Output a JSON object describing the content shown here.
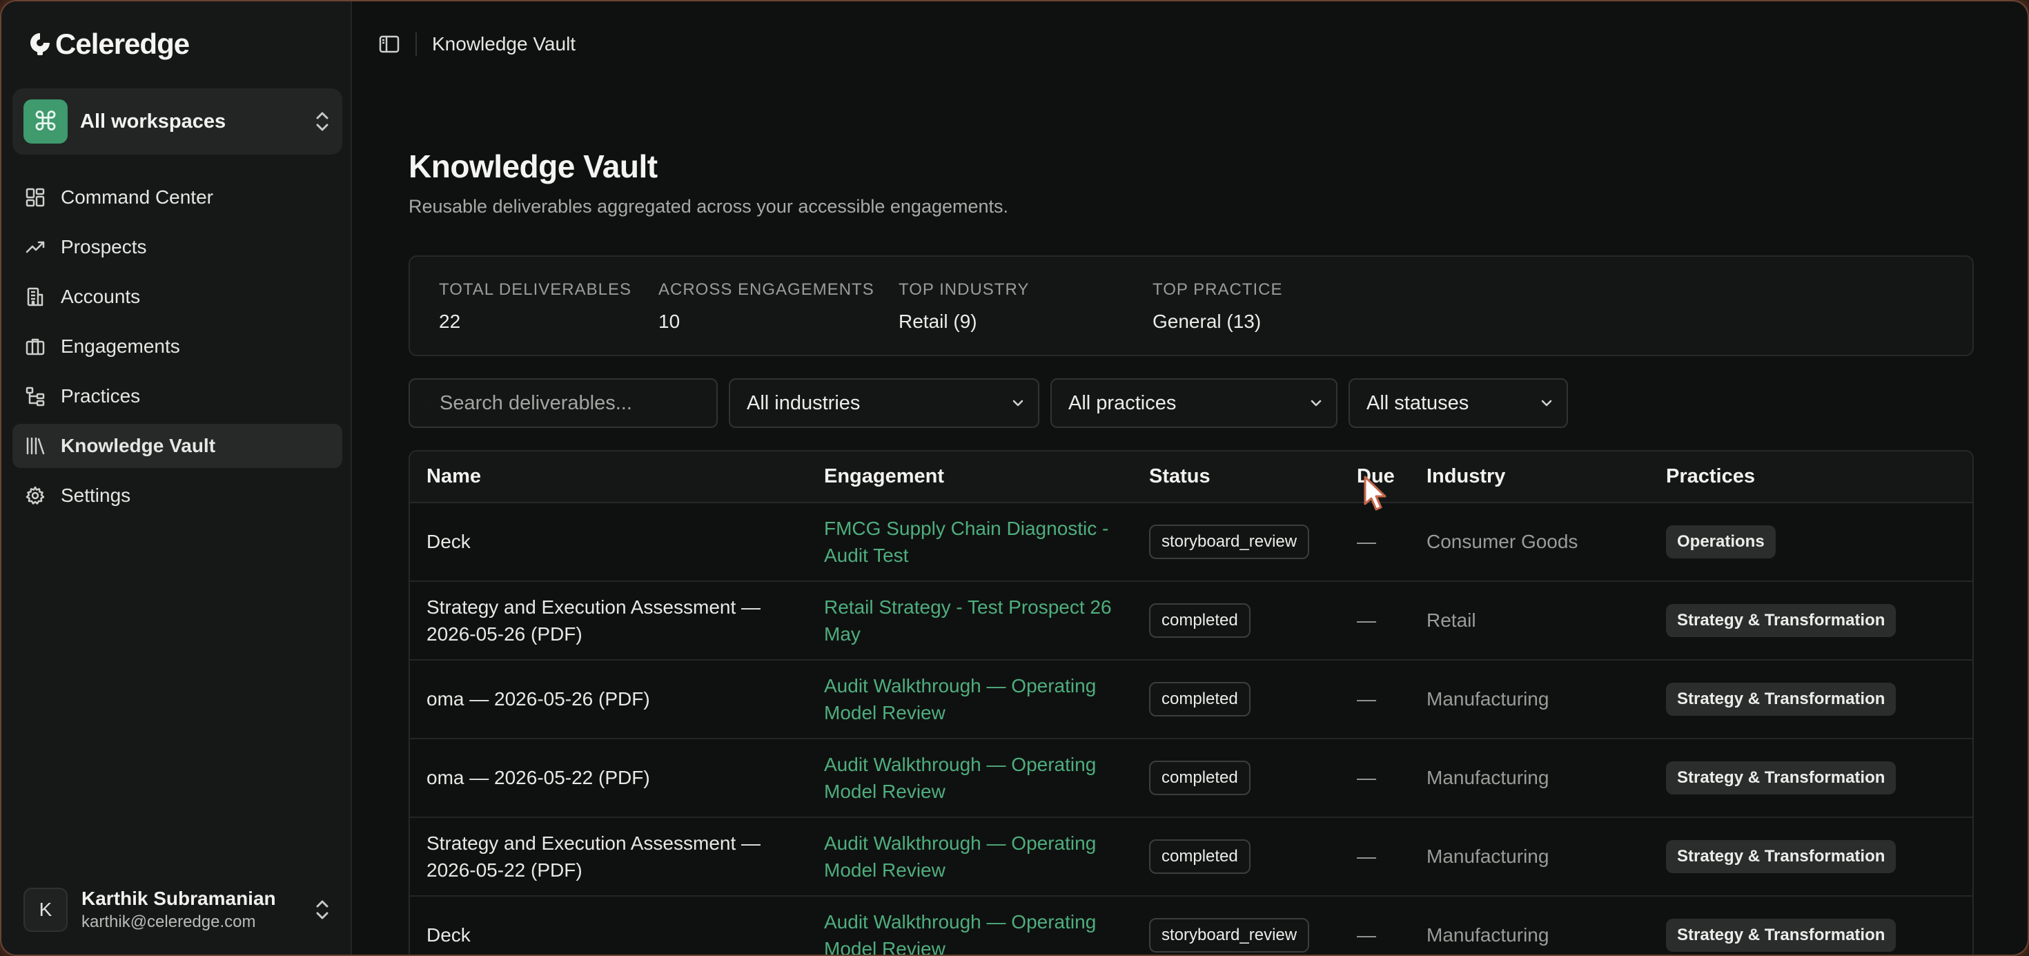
{
  "brand": {
    "name": "Celeredge",
    "icon": "celeredge-logo"
  },
  "workspace": {
    "label": "All workspaces",
    "icon": "command-icon",
    "glyph": "⌘"
  },
  "nav": [
    {
      "label": "Command Center",
      "icon": "dashboard-icon",
      "active": false
    },
    {
      "label": "Prospects",
      "icon": "trending-up-icon",
      "active": false
    },
    {
      "label": "Accounts",
      "icon": "building-icon",
      "active": false
    },
    {
      "label": "Engagements",
      "icon": "briefcase-icon",
      "active": false
    },
    {
      "label": "Practices",
      "icon": "tree-icon",
      "active": false
    },
    {
      "label": "Knowledge Vault",
      "icon": "library-icon",
      "active": true
    },
    {
      "label": "Settings",
      "icon": "gear-icon",
      "active": false
    }
  ],
  "user": {
    "initial": "K",
    "name": "Karthik Subramanian",
    "email": "karthik@celeredge.com"
  },
  "topbar": {
    "breadcrumb": "Knowledge Vault"
  },
  "page": {
    "title": "Knowledge Vault",
    "subtitle": "Reusable deliverables aggregated across your accessible engagements."
  },
  "stats": [
    {
      "label": "Total deliverables",
      "value": "22"
    },
    {
      "label": "Across engagements",
      "value": "10"
    },
    {
      "label": "Top industry",
      "value": "Retail (9)"
    },
    {
      "label": "Top practice",
      "value": "General (13)"
    }
  ],
  "filters": {
    "search_placeholder": "Search deliverables...",
    "industry": "All industries",
    "practice": "All practices",
    "status": "All statuses"
  },
  "table": {
    "headers": [
      "Name",
      "Engagement",
      "Status",
      "Due",
      "Industry",
      "Practices"
    ],
    "rows": [
      {
        "name": "Deck",
        "engagement": "FMCG Supply Chain Diagnostic - Audit Test",
        "status": "storyboard_review",
        "due": "—",
        "industry": "Consumer Goods",
        "practice": "Operations"
      },
      {
        "name": "Strategy and Execution Assessment — 2026-05-26 (PDF)",
        "engagement": "Retail Strategy - Test Prospect 26 May",
        "status": "completed",
        "due": "—",
        "industry": "Retail",
        "practice": "Strategy & Transformation"
      },
      {
        "name": "oma — 2026-05-26 (PDF)",
        "engagement": "Audit Walkthrough — Operating Model Review",
        "status": "completed",
        "due": "—",
        "industry": "Manufacturing",
        "practice": "Strategy & Transformation"
      },
      {
        "name": "oma — 2026-05-22 (PDF)",
        "engagement": "Audit Walkthrough — Operating Model Review",
        "status": "completed",
        "due": "—",
        "industry": "Manufacturing",
        "practice": "Strategy & Transformation"
      },
      {
        "name": "Strategy and Execution Assessment — 2026-05-22 (PDF)",
        "engagement": "Audit Walkthrough — Operating Model Review",
        "status": "completed",
        "due": "—",
        "industry": "Manufacturing",
        "practice": "Strategy & Transformation"
      },
      {
        "name": "Deck",
        "engagement": "Audit Walkthrough — Operating Model Review",
        "status": "storyboard_review",
        "due": "—",
        "industry": "Manufacturing",
        "practice": "Strategy & Transformation"
      }
    ]
  },
  "colors": {
    "accent": "#4fae7e",
    "badge": "#3f9a6e",
    "background": "#0f1110",
    "sidebar": "#161817"
  }
}
